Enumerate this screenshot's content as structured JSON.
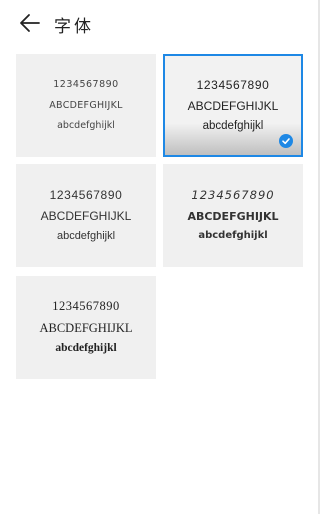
{
  "header": {
    "title": "字体"
  },
  "accent_color": "#1e88e5",
  "fonts": [
    {
      "digits": "1234567890",
      "upper": "ABCDEFGHIJKL",
      "lower": "abcdefghijkl",
      "selected": false
    },
    {
      "digits": "1234567890",
      "upper": "ABCDEFGHIJKL",
      "lower": "abcdefghijkl",
      "selected": true
    },
    {
      "digits": "1234567890",
      "upper": "ABCDEFGHIJKL",
      "lower": "abcdefghijkl",
      "selected": false
    },
    {
      "digits": "1234567890",
      "upper": "ABCDEFGHIJKL",
      "lower": "abcdefghijkl",
      "selected": false
    },
    {
      "digits": "1234567890",
      "upper": "ABCDEFGHIJKL",
      "lower": "abcdefghijkl",
      "selected": false
    }
  ]
}
